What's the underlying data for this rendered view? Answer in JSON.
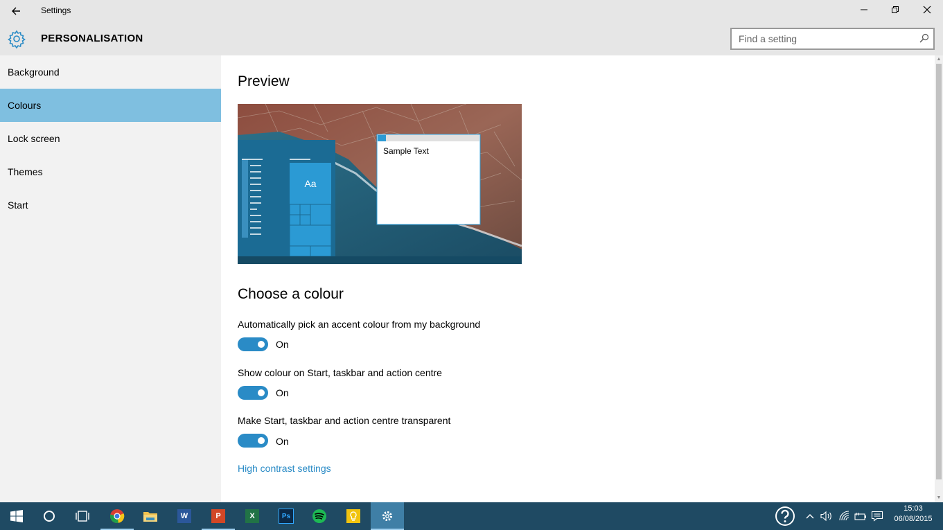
{
  "window": {
    "title": "Settings",
    "back_label": "Back",
    "controls": {
      "minimize": "Minimize",
      "restore": "Restore",
      "close": "Close"
    }
  },
  "header": {
    "title": "PERSONALISATION",
    "search_placeholder": "Find a setting"
  },
  "sidebar": {
    "items": [
      {
        "label": "Background",
        "active": false
      },
      {
        "label": "Colours",
        "active": true
      },
      {
        "label": "Lock screen",
        "active": false
      },
      {
        "label": "Themes",
        "active": false
      },
      {
        "label": "Start",
        "active": false
      }
    ]
  },
  "content": {
    "preview_heading": "Preview",
    "preview": {
      "sample_text": "Sample Text",
      "tile_label": "Aa"
    },
    "colour_heading": "Choose a colour",
    "settings": [
      {
        "label": "Automatically pick an accent colour from my background",
        "state": "On"
      },
      {
        "label": "Show colour on Start, taskbar and action centre",
        "state": "On"
      },
      {
        "label": "Make Start, taskbar and action centre transparent",
        "state": "On"
      }
    ],
    "link": "High contrast settings"
  },
  "taskbar": {
    "apps": [
      {
        "name": "start-icon"
      },
      {
        "name": "cortana-icon"
      },
      {
        "name": "task-view-icon"
      },
      {
        "name": "chrome-icon",
        "running": true
      },
      {
        "name": "file-explorer-icon"
      },
      {
        "name": "word-icon",
        "letter": "W"
      },
      {
        "name": "powerpoint-icon",
        "letter": "P",
        "running": true
      },
      {
        "name": "excel-icon",
        "letter": "X"
      },
      {
        "name": "photoshop-icon",
        "letter": "Ps"
      },
      {
        "name": "spotify-icon"
      },
      {
        "name": "tips-icon"
      },
      {
        "name": "settings-icon",
        "active": true
      }
    ],
    "clock": {
      "time": "15:03",
      "date": "06/08/2015"
    }
  },
  "colors": {
    "accent": "#2a8bc6",
    "selection": "#7fbfe0",
    "taskbar": "#1f4a63",
    "chrome_bg": "#e6e6e6",
    "sidebar_bg": "#f2f2f2"
  }
}
